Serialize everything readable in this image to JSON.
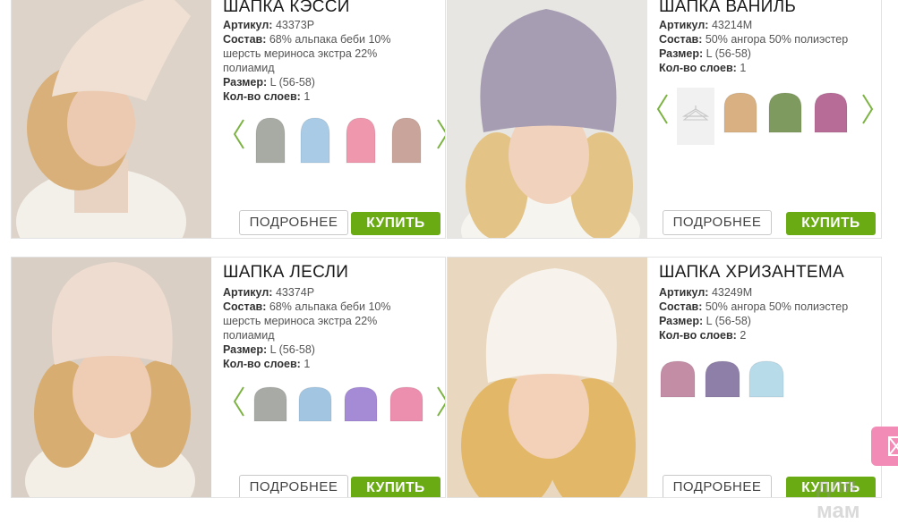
{
  "labels": {
    "article": "Артикул:",
    "composition": "Состав:",
    "size": "Размер:",
    "layers": "Кол-во слоев:",
    "more_button": "ПОДРОБНЕЕ",
    "buy_button": "КУПИТЬ"
  },
  "products": [
    {
      "title": "ШАПКА КЭССИ",
      "article": "43373P",
      "composition": "68% альпака беби 10% шерсть мериноса экстра 22% полиамид",
      "size": "L (56-58)",
      "layers": "1",
      "hat_color": "#efe0d3",
      "swatches": [
        "#a7aba3",
        "#a9cbe5",
        "#ee97ad",
        "#c9a49a"
      ]
    },
    {
      "title": "ШАПКА ВАНИЛЬ",
      "article": "43214M",
      "composition": "50% ангора 50% полиэстер",
      "size": "L (56-58)",
      "layers": "1",
      "hat_color": "#a79db3",
      "swatches": [
        "placeholder",
        "#d9b081",
        "#7f9a5e",
        "#b76c97"
      ]
    },
    {
      "title": "ШАПКА ЛЕСЛИ",
      "article": "43374P",
      "composition": "68% альпака беби 10% шерсть мериноса экстра 22% полиамид",
      "size": "L (56-58)",
      "layers": "1",
      "hat_color": "#eedcd0",
      "swatches": [
        "#a8aaa5",
        "#a2c6e2",
        "#a58ad6",
        "#ec8fae"
      ]
    },
    {
      "title": "ШАПКА ХРИЗАНТЕМА",
      "article": "43249M",
      "composition": "50% ангора 50% полиэстер",
      "size": "L (56-58)",
      "layers": "2",
      "hat_color": "#f7f3ec",
      "swatches": [
        "#c48da6",
        "#8e7fa8",
        "#b8dbea"
      ]
    }
  ],
  "colors": {
    "buy_button": "#6aab14",
    "arrow": "#7cb342",
    "side_tab": "#f28bb5"
  },
  "watermark": "для мам"
}
